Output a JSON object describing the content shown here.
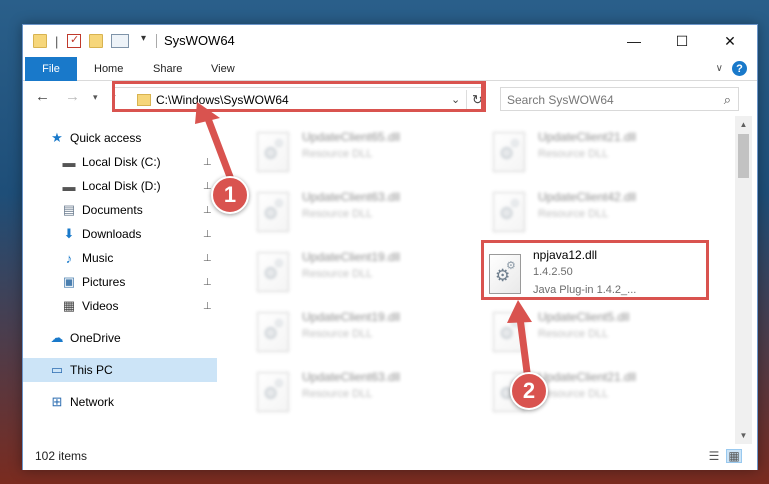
{
  "window": {
    "title": "SysWOW64",
    "controls": {
      "minimize": "—",
      "maximize": "☐",
      "close": "✕"
    }
  },
  "ribbon": {
    "file_tab": "File",
    "tabs": [
      "Home",
      "Share",
      "View"
    ],
    "help": "?"
  },
  "navigation": {
    "back": "←",
    "forward": "→",
    "recent": "▾",
    "up": "↑",
    "address_path": "C:\\Windows\\SysWOW64",
    "search_placeholder": "Search SysWOW64"
  },
  "sidebar": {
    "items": [
      {
        "label": "Quick access",
        "icon": "star-icon",
        "glyph": "★",
        "color": "#1979ca",
        "pinned": false
      },
      {
        "label": "Local Disk (C:)",
        "icon": "disk-icon",
        "glyph": "▬",
        "color": "#555555",
        "pinned": true
      },
      {
        "label": "Local Disk (D:)",
        "icon": "disk-icon",
        "glyph": "▬",
        "color": "#555555",
        "pinned": true
      },
      {
        "label": "Documents",
        "icon": "documents-icon",
        "glyph": "▤",
        "color": "#6b7c8f",
        "pinned": true
      },
      {
        "label": "Downloads",
        "icon": "download-icon",
        "glyph": "⬇",
        "color": "#1979ca",
        "pinned": true
      },
      {
        "label": "Music",
        "icon": "music-icon",
        "glyph": "♪",
        "color": "#1979ca",
        "pinned": true
      },
      {
        "label": "Pictures",
        "icon": "pictures-icon",
        "glyph": "▣",
        "color": "#4a7fb0",
        "pinned": true
      },
      {
        "label": "Videos",
        "icon": "videos-icon",
        "glyph": "▦",
        "color": "#444444",
        "pinned": true
      },
      {
        "label": "OneDrive",
        "icon": "cloud-icon",
        "glyph": "☁",
        "color": "#1979ca",
        "pinned": false
      },
      {
        "label": "This PC",
        "icon": "computer-icon",
        "glyph": "▭",
        "color": "#2b6cb0",
        "pinned": false,
        "selected": true
      },
      {
        "label": "Network",
        "icon": "network-icon",
        "glyph": "⊞",
        "color": "#2b6cb0",
        "pinned": false
      }
    ],
    "pin_glyph": "📌"
  },
  "files": [
    {
      "name": "UpdateClient65.dll",
      "type": "Resource DLL"
    },
    {
      "name": "UpdateClient21.dll",
      "type": "Resource DLL"
    },
    {
      "name": "UpdateClient63.dll",
      "type": "Resource DLL"
    },
    {
      "name": "UpdateClient42.dll",
      "type": "Resource DLL"
    },
    {
      "name": "UpdateClient19.dll",
      "type": "Resource DLL"
    },
    {
      "name": "npjava12.dll",
      "version": "1.4.2.50",
      "type": "Java Plug-in 1.4.2_..."
    },
    {
      "name": "UpdateClient19.dll",
      "type": "Resource DLL"
    },
    {
      "name": "UpdateClient5.dll",
      "type": "Resource DLL"
    },
    {
      "name": "UpdateClient63.dll",
      "type": "Resource DLL"
    },
    {
      "name": "UpdateClient21.dll",
      "type": "Resource DLL"
    }
  ],
  "status": {
    "item_count": "102 items"
  },
  "annotations": {
    "step1": "1",
    "step2": "2",
    "color": "#d9534f"
  }
}
